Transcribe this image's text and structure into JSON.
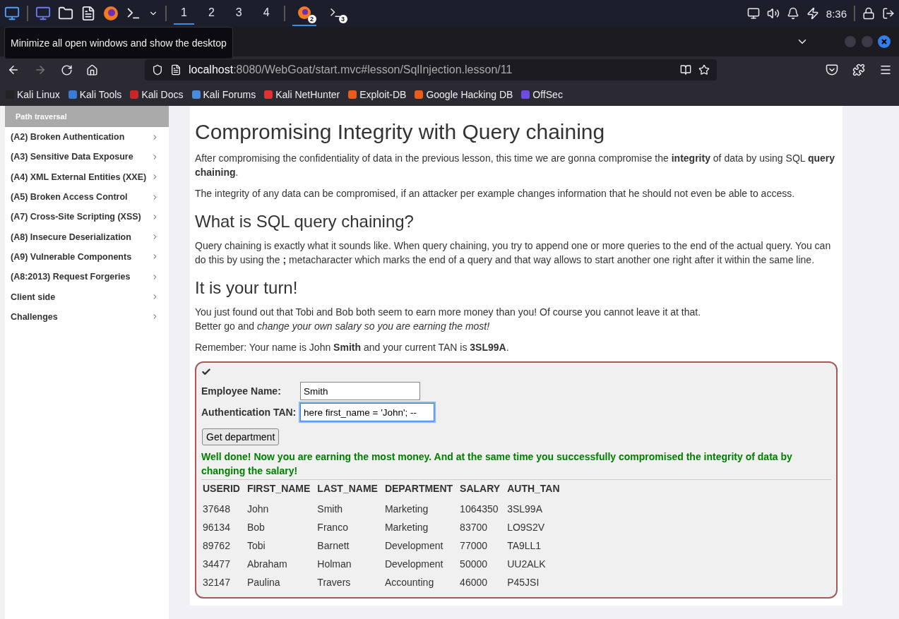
{
  "taskbar": {
    "workspaces": [
      {
        "label": "1",
        "selected": true
      },
      {
        "label": "2",
        "selected": false
      },
      {
        "label": "3",
        "selected": false
      },
      {
        "label": "4",
        "selected": false
      }
    ],
    "tasks": [
      {
        "kind": "firefox",
        "badge": "2",
        "selected": true
      },
      {
        "kind": "terminal",
        "badge": "3",
        "selected": false
      }
    ],
    "clock": "8:36"
  },
  "tooltip": "Minimize all open windows and show the desktop",
  "browser": {
    "url_host": "localhost",
    "url_rest": ":8080/WebGoat/start.mvc#lesson/SqlInjection.lesson/11",
    "bookmarks": [
      "Kali Linux",
      "Kali Tools",
      "Kali Docs",
      "Kali Forums",
      "Kali NetHunter",
      "Exploit-DB",
      "Google Hacking DB",
      "OffSec"
    ]
  },
  "sidebar": {
    "header": "Path traversal",
    "items": [
      "(A2) Broken Authentication",
      "(A3) Sensitive Data Exposure",
      "(A4) XML External Entities (XXE)",
      "(A5) Broken Access Control",
      "(A7) Cross-Site Scripting (XSS)",
      "(A8) Insecure Deserialization",
      "(A9) Vulnerable Components",
      "(A8:2013) Request Forgeries",
      "Client side",
      "Challenges"
    ]
  },
  "lesson": {
    "title": "Compromising Integrity with Query chaining",
    "intro": [
      "After compromising the confidentiality of data in the previous lesson, this time we are gonna compromise the **integrity** of data by using SQL **query chaining**.",
      "The integrity of any data can be compromised, if an attacker per example changes information that he should not even be able to access."
    ],
    "h2": "What is SQL query chaining?",
    "chaining": "Query chaining is exactly what it sounds like. When query chaining, you try to append one or more queries to the end of the actual query. You can do this by using the **;** metacharacter which marks the end of a query and that way allows to start another one right after it within the same line.",
    "h3": "It is your turn!",
    "turn_lines": [
      "You just found out that Tobi and Bob both seem to earn more money than you! Of course you cannot leave it at that.",
      "Better go and *change your own salary so you are earning the most!*"
    ],
    "remember": "Remember: Your name is John **Smith** and your current TAN is **3SL99A**."
  },
  "form": {
    "solved": true,
    "name_label": "Employee Name:",
    "name_value": "Smith",
    "tan_label": "Authentication TAN:",
    "tan_value": "here first_name = 'John'; --",
    "button": "Get department",
    "feedback": "Well done! Now you are earning the most money. And at the same time you successfully compromised the integrity of data by changing the salary!"
  },
  "table": {
    "columns": [
      "USERID",
      "FIRST_NAME",
      "LAST_NAME",
      "DEPARTMENT",
      "SALARY",
      "AUTH_TAN"
    ],
    "rows": [
      [
        "37648",
        "John",
        "Smith",
        "Marketing",
        "1064350",
        "3SL99A"
      ],
      [
        "96134",
        "Bob",
        "Franco",
        "Marketing",
        "83700",
        "LO9S2V"
      ],
      [
        "89762",
        "Tobi",
        "Barnett",
        "Development",
        "77000",
        "TA9LL1"
      ],
      [
        "34477",
        "Abraham",
        "Holman",
        "Development",
        "50000",
        "UU2ALK"
      ],
      [
        "32147",
        "Paulina",
        "Travers",
        "Accounting",
        "46000",
        "P45JSI"
      ]
    ]
  }
}
